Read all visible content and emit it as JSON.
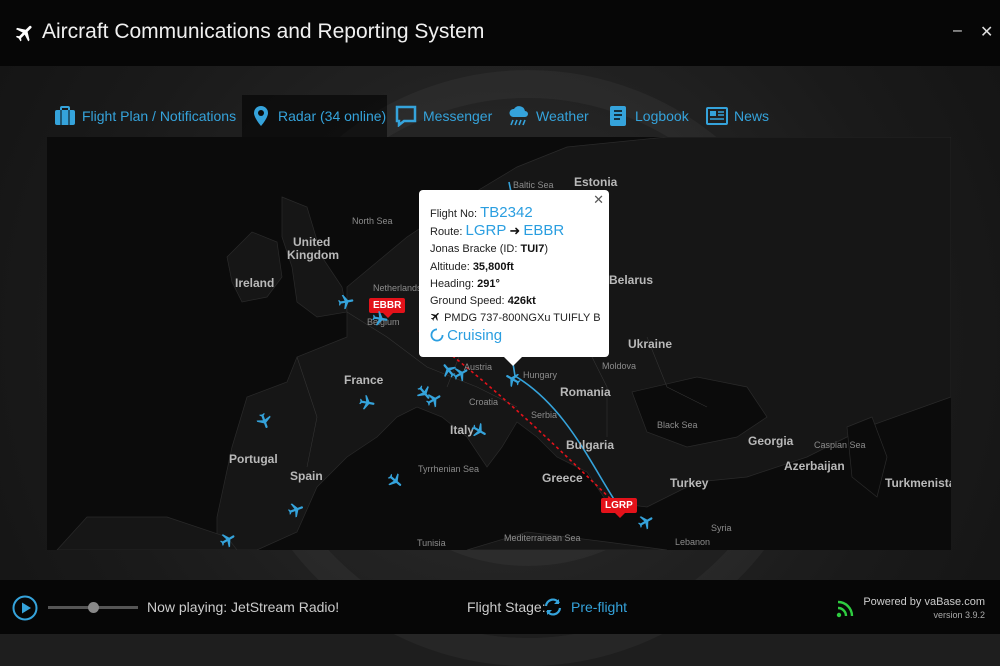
{
  "window": {
    "title": "Aircraft Communications and Reporting System",
    "minimize": "–",
    "close": "✕"
  },
  "tabs": [
    {
      "label": "Flight Plan / Notifications",
      "icon": "briefcase-icon"
    },
    {
      "label": "Radar (34 online)",
      "icon": "map-pin-icon",
      "active": true
    },
    {
      "label": "Messenger",
      "icon": "chat-bubble-icon"
    },
    {
      "label": "Weather",
      "icon": "cloud-rain-icon"
    },
    {
      "label": "Logbook",
      "icon": "book-icon"
    },
    {
      "label": "News",
      "icon": "newspaper-icon"
    }
  ],
  "map": {
    "labels": {
      "north_sea": "North Sea",
      "baltic_sea": "Baltic Sea",
      "estonia": "Estonia",
      "uk1": "United",
      "uk2": "Kingdom",
      "ireland": "Ireland",
      "netherlands": "Netherlands",
      "belgium": "Belgium",
      "belarus": "Belarus",
      "ukraine": "Ukraine",
      "moldova": "Moldova",
      "france": "France",
      "austria": "Austria",
      "hungary": "Hungary",
      "romania": "Romania",
      "croatia": "Croatia",
      "serbia": "Serbia",
      "italy": "Italy",
      "bulgaria": "Bulgaria",
      "black_sea": "Black Sea",
      "georgia": "Georgia",
      "caspian_sea": "Caspian Sea",
      "azerbaijan": "Azerbaijan",
      "portugal": "Portugal",
      "spain": "Spain",
      "tyrrhenian_sea": "Tyrrhenian Sea",
      "greece": "Greece",
      "turkey": "Turkey",
      "turkmenistan": "Turkmenista",
      "syria": "Syria",
      "lebanon": "Lebanon",
      "tunisia": "Tunisia",
      "mediterranean_sea": "Mediterranean Sea"
    },
    "airports": {
      "origin": "LGRP",
      "destination": "EBBR"
    },
    "route_color": "#35a3db",
    "planned_route_color": "#e3121a"
  },
  "popup": {
    "close": "✕",
    "flight_no_label": "Flight No:",
    "flight_no": "TB2342",
    "route_label": "Route:",
    "route_from": "LGRP",
    "route_arrow": "➜",
    "route_to": "EBBR",
    "pilot_name": "Jonas Bracke (ID: ",
    "pilot_id": "TUI7",
    "pilot_close": ")",
    "altitude_label": "Altitude:",
    "altitude": "35,800ft",
    "heading_label": "Heading:",
    "heading": "291°",
    "gs_label": "Ground Speed:",
    "gs": "426kt",
    "aircraft": "PMDG 737-800NGXu TUIFLY B",
    "status": "Cruising"
  },
  "player": {
    "now_playing": "Now playing: JetStream Radio!",
    "volume": 0.5
  },
  "flight_stage": {
    "label": "Flight Stage:",
    "value": "Pre-flight"
  },
  "footer": {
    "powered_by": "Powered by vaBase.com",
    "version": "version 3.9.2"
  },
  "colors": {
    "accent": "#35a3db",
    "red": "#e3121a",
    "signal": "#2ecc40"
  }
}
